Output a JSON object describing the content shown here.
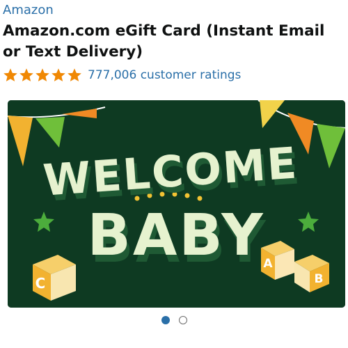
{
  "product": {
    "brand": "Amazon",
    "title": "Amazon.com eGift Card (Instant Email or Text Delivery)",
    "star_rating": 5,
    "ratings_text": "777,006 customer ratings"
  },
  "card_image": {
    "line1": "WELCOME",
    "line2": "BABY",
    "block_left": "C",
    "block_right_a": "A",
    "block_right_b": "B",
    "icons": [
      "bunting-flags",
      "star-icon",
      "toy-block"
    ]
  },
  "carousel": {
    "count": 2,
    "active_index": 0
  },
  "colors": {
    "link": "#2a6fa8",
    "star": "#f08804",
    "card_bg": "#0e3a22",
    "card_text": "#e6f2cf"
  }
}
